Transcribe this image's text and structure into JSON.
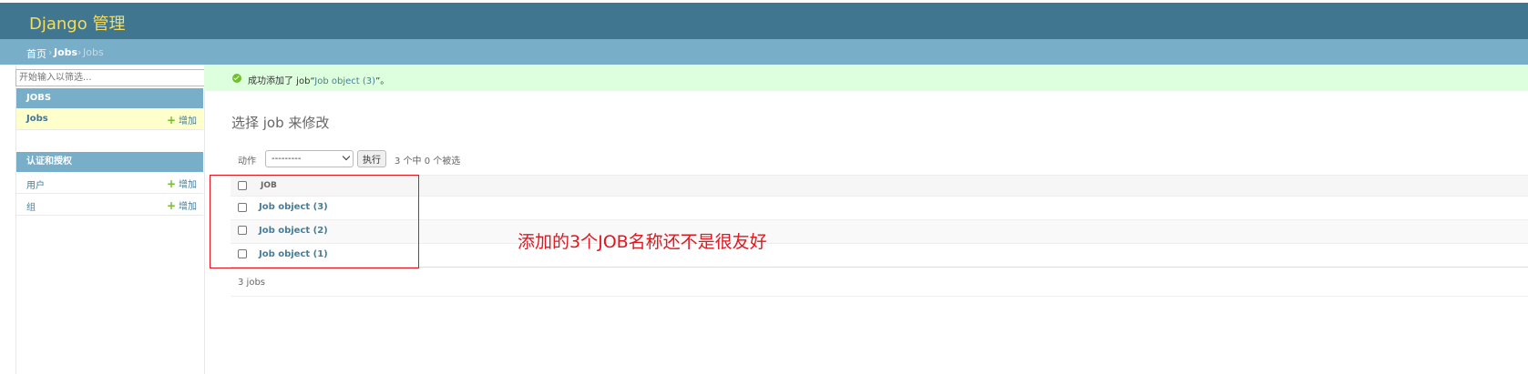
{
  "header": {
    "brand": "Django 管理"
  },
  "breadcrumbs": {
    "home": "首页",
    "sep1": "›",
    "app": "Jobs",
    "sep2": "›",
    "current": "Jobs"
  },
  "sidebar": {
    "filter_placeholder": "开始输入以筛选...",
    "modules": [
      {
        "caption": "JOBS",
        "items": [
          {
            "label": "Jobs",
            "add": "增加"
          }
        ]
      },
      {
        "caption": "认证和授权",
        "items": [
          {
            "label": "用户",
            "add": "增加"
          },
          {
            "label": "组",
            "add": "增加"
          }
        ]
      }
    ],
    "add_symbol": "+"
  },
  "message": {
    "prefix": "成功添加了 job“",
    "link": "Job object (3)",
    "suffix": "”。"
  },
  "content": {
    "title": "选择 job 来修改",
    "actions": {
      "label": "动作",
      "selected": "---------",
      "go": "执行",
      "counter": "3 个中 0 个被选"
    },
    "table": {
      "column": "JOB",
      "rows": [
        "Job object (3)",
        "Job object (2)",
        "Job object (1)"
      ]
    },
    "paginator": "3 jobs"
  },
  "annotation": {
    "text": "添加的3个JOB名称还不是很友好",
    "color": "#e3161e"
  },
  "colors": {
    "header_bg": "#417690",
    "brand": "#f5dd5d",
    "breadcrumb_bg": "#79aec8",
    "link": "#447e9b",
    "success_bg": "#ddffdd",
    "add_green": "#70bf2b"
  },
  "icons": {
    "success": "success-check-icon",
    "add": "add-plus-icon",
    "dropdown": "chevron-down-icon"
  }
}
